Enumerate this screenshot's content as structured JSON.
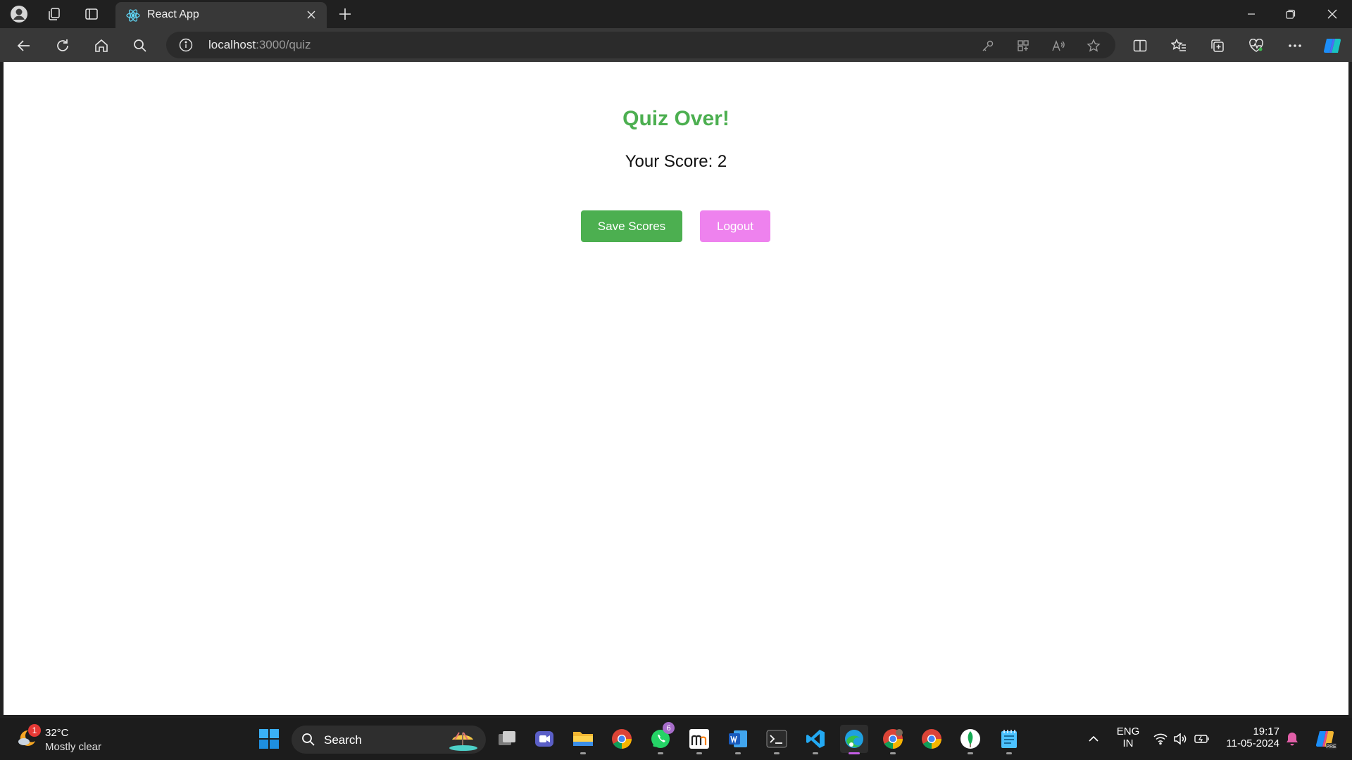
{
  "browser": {
    "tab": {
      "title": "React App"
    },
    "address": {
      "host": "localhost",
      "path": ":3000/quiz"
    }
  },
  "page": {
    "heading": "Quiz Over!",
    "score_label": "Your Score: 2",
    "save_button": "Save Scores",
    "logout_button": "Logout",
    "colors": {
      "heading": "#4caf50",
      "save": "#4caf50",
      "logout": "#ee82ee"
    }
  },
  "taskbar": {
    "weather": {
      "temp": "32°C",
      "condition": "Mostly clear",
      "badge": "1"
    },
    "search": {
      "label": "Search"
    },
    "whatsapp_badge": "6",
    "tray": {
      "language": "ENG",
      "region": "IN",
      "time": "19:17",
      "date": "11-05-2024"
    }
  }
}
